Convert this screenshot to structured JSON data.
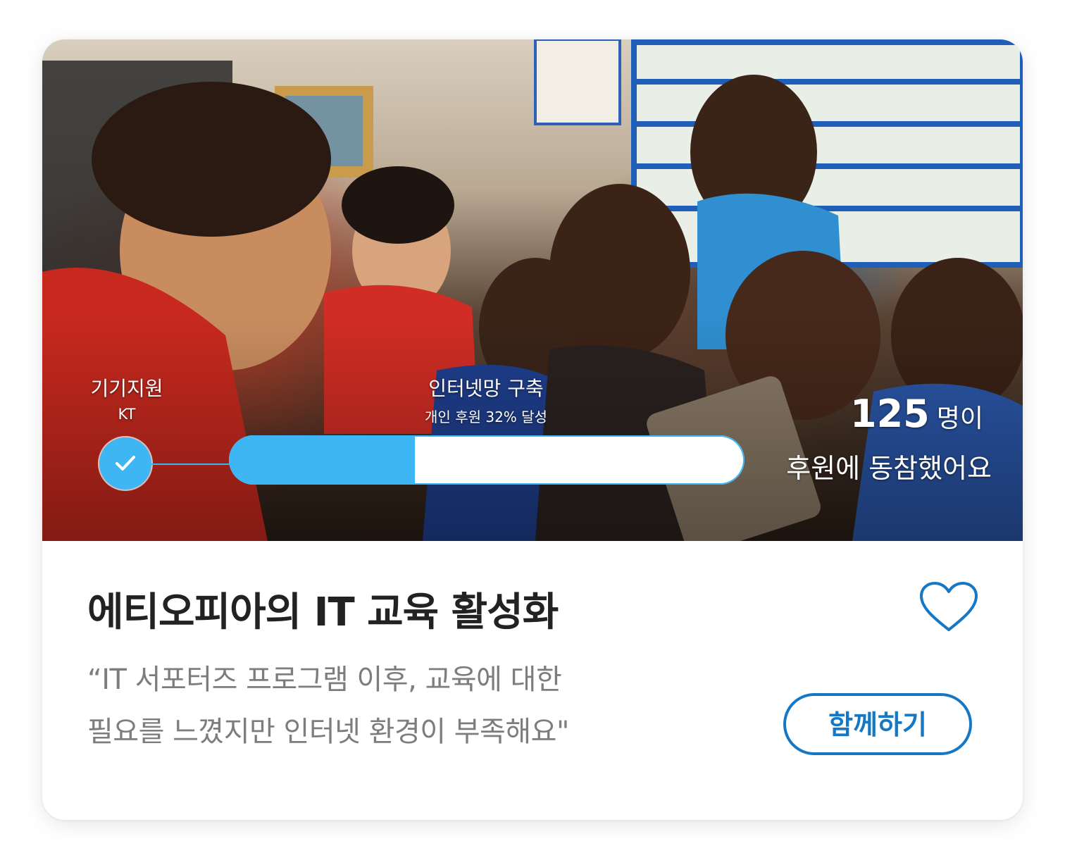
{
  "campaign": {
    "title": "에티오피아의 IT 교육 활성화",
    "quote_line1": "“IT 서포터즈 프로그램 이후, 교육에 대한",
    "quote_line2": "필요를 느꼈지만 인터넷 환경이 부족해요\"",
    "join_label": "함께하기",
    "favorite_icon": "heart-outline-icon"
  },
  "steps": [
    {
      "title": "기기지원",
      "subtitle": "KT",
      "status": "completed",
      "icon": "check-icon"
    },
    {
      "title": "인터넷망 구축",
      "subtitle": "개인 후원 32% 달성",
      "progress": 0.36
    }
  ],
  "supporters": {
    "count": "125",
    "unit": "명이",
    "caption": "후원에 동참했어요"
  },
  "colors": {
    "accent": "#3eb6f3",
    "button": "#1677c4",
    "title": "#222222",
    "quote": "#7d7d7d"
  }
}
